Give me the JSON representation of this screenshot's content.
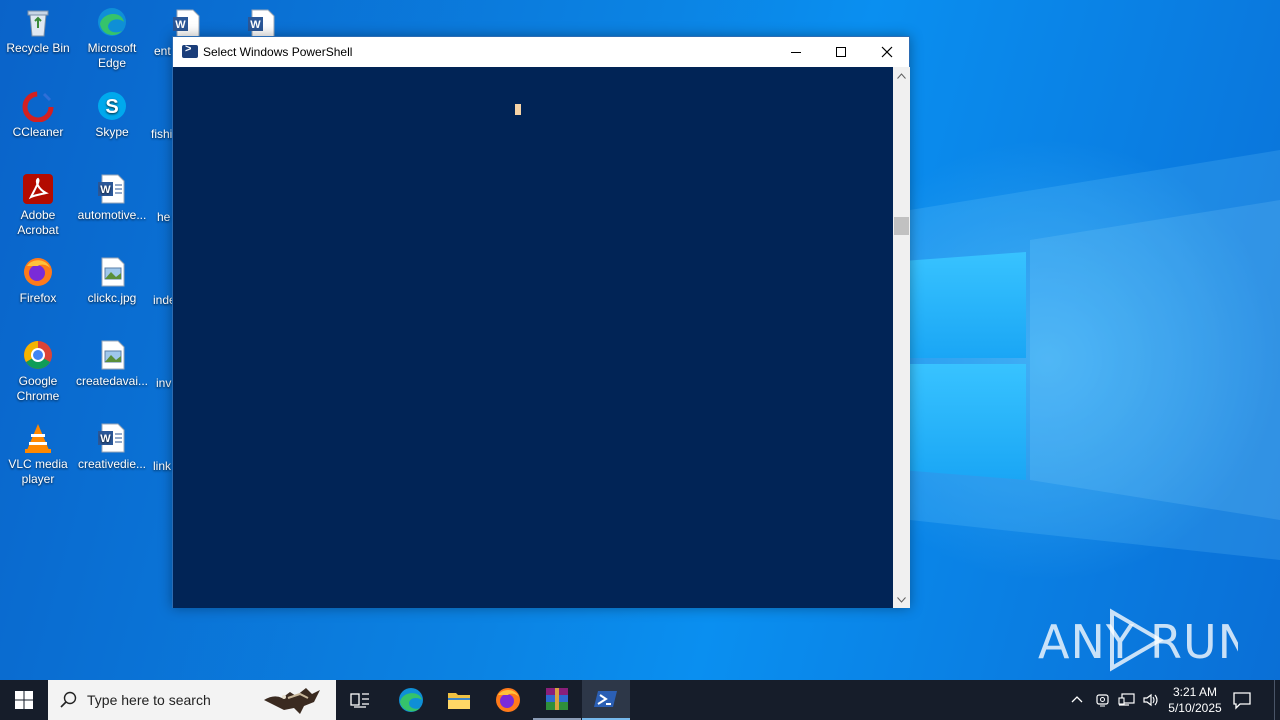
{
  "desktop": {
    "icons_col1": [
      {
        "label": "Recycle Bin",
        "icon": "recycle-bin-icon"
      },
      {
        "label": "CCleaner",
        "icon": "ccleaner-icon"
      },
      {
        "label": "Adobe Acrobat",
        "icon": "acrobat-icon"
      },
      {
        "label": "Firefox",
        "icon": "firefox-icon"
      },
      {
        "label": "Google Chrome",
        "icon": "chrome-icon"
      },
      {
        "label": "VLC media player",
        "icon": "vlc-icon"
      }
    ],
    "icons_col2": [
      {
        "label": "Microsoft Edge",
        "icon": "edge-icon"
      },
      {
        "label": "Skype",
        "icon": "skype-icon"
      },
      {
        "label": "automotive...",
        "icon": "word-doc-icon"
      },
      {
        "label": "clickc.jpg",
        "icon": "image-file-icon"
      },
      {
        "label": "createdavai...",
        "icon": "image-file-icon"
      },
      {
        "label": "creativedie...",
        "icon": "word-doc-icon"
      }
    ],
    "icons_col3_partial": [
      "ent",
      "fishi",
      "he",
      "inde",
      "inv",
      "link"
    ]
  },
  "window": {
    "title": "Select Windows PowerShell",
    "minimize": "minimize",
    "maximize": "maximize",
    "close": "close"
  },
  "watermark": "ANY RUN",
  "taskbar": {
    "search_placeholder": "Type here to search",
    "apps": [
      "task-view",
      "edge",
      "file-explorer",
      "firefox",
      "winrar",
      "powershell"
    ],
    "time": "3:21 AM",
    "date": "5/10/2025"
  },
  "colors": {
    "console_bg": "#012456",
    "taskbar_bg": "#161d2a",
    "accent": "#76b9ed"
  }
}
